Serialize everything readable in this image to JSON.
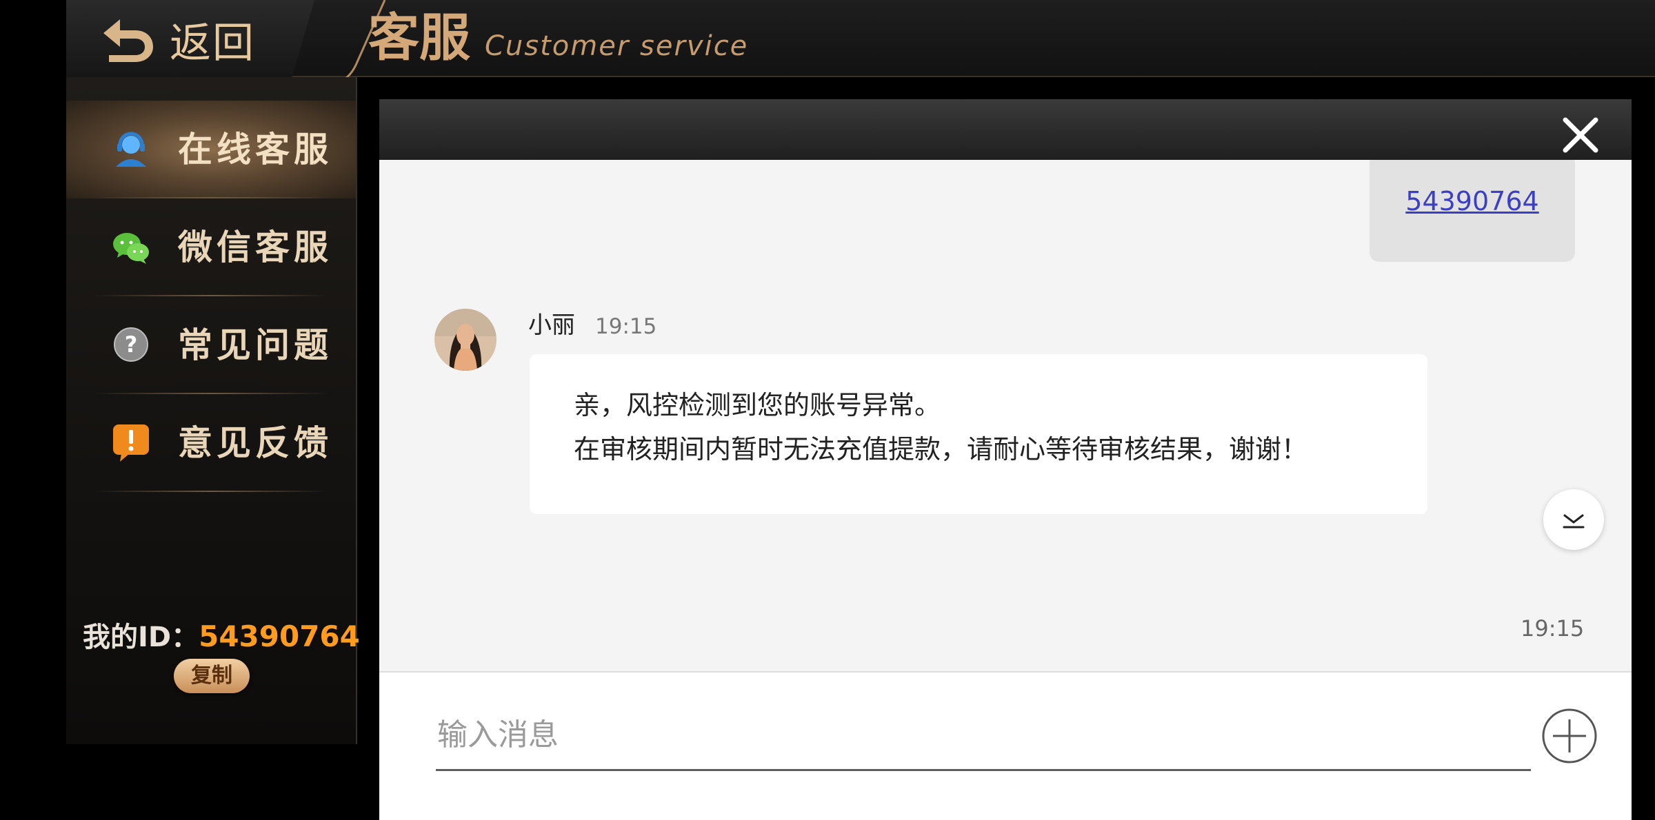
{
  "header": {
    "back_label": "返回",
    "title": "客服",
    "subtitle": "Customer service"
  },
  "sidebar": {
    "items": [
      {
        "label": "在线客服",
        "icon": "headset-agent-icon",
        "active": true
      },
      {
        "label": "微信客服",
        "icon": "wechat-icon",
        "active": false
      },
      {
        "label": "常见问题",
        "icon": "question-mark-icon",
        "active": false
      },
      {
        "label": "意见反馈",
        "icon": "exclamation-bubble-icon",
        "active": false
      }
    ],
    "my_id_label": "我的ID：",
    "my_id_value": "54390764",
    "copy_label": "复制"
  },
  "chat": {
    "sent_message": "54390764",
    "agent": {
      "name": "小丽",
      "time": "19:15",
      "lines": [
        "亲，风控检测到您的账号异常。",
        "在审核期间内暂时无法充值提款，请耐心等待审核结果，谢谢！"
      ]
    },
    "partial_timestamp": "19:15",
    "input_placeholder": "输入消息"
  },
  "colors": {
    "gold_accent": "#d4a879",
    "id_orange": "#ff9b1e",
    "link_blue": "#3b3fc4",
    "chat_background": "#f4f4f4"
  }
}
